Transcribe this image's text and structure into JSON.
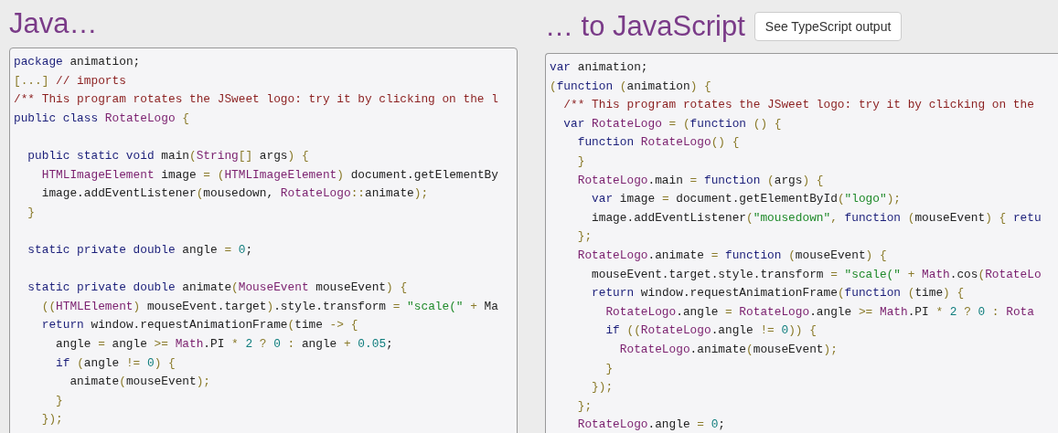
{
  "panels": [
    {
      "heading": "Java…",
      "code": [
        {
          "kind": "code",
          "tokens": [
            {
              "kind": "keyword",
              "text": "package"
            },
            {
              "kind": "identifier",
              "text": " animation;"
            }
          ]
        },
        {
          "kind": "code",
          "tokens": [
            {
              "kind": "punctuation",
              "text": "[...]"
            },
            {
              "kind": "comment",
              "text": " // imports"
            }
          ]
        },
        {
          "kind": "code",
          "tokens": [
            {
              "kind": "comment",
              "text": "/** This program rotates the JSweet logo: try it by clicking on the l"
            }
          ]
        },
        {
          "kind": "code",
          "tokens": [
            {
              "kind": "keyword",
              "text": "public class "
            },
            {
              "kind": "type",
              "text": "RotateLogo"
            },
            {
              "kind": "punctuation",
              "text": " {"
            }
          ]
        },
        {
          "kind": "blank"
        },
        {
          "kind": "code",
          "tokens": [
            {
              "kind": "keyword",
              "text": "  public static void "
            },
            {
              "kind": "identifier",
              "text": "main"
            },
            {
              "kind": "punctuation",
              "text": "("
            },
            {
              "kind": "type",
              "text": "String"
            },
            {
              "kind": "punctuation",
              "text": "[]"
            },
            {
              "kind": "identifier",
              "text": " args"
            },
            {
              "kind": "punctuation",
              "text": ") {"
            }
          ]
        },
        {
          "kind": "code",
          "tokens": [
            {
              "kind": "type",
              "text": "    HTMLImageElement"
            },
            {
              "kind": "identifier",
              "text": " image "
            },
            {
              "kind": "punctuation",
              "text": "= ("
            },
            {
              "kind": "type",
              "text": "HTMLImageElement"
            },
            {
              "kind": "punctuation",
              "text": ")"
            },
            {
              "kind": "identifier",
              "text": " document.getElementBy"
            }
          ]
        },
        {
          "kind": "code",
          "tokens": [
            {
              "kind": "identifier",
              "text": "    image.addEventListener"
            },
            {
              "kind": "punctuation",
              "text": "("
            },
            {
              "kind": "identifier",
              "text": "mousedown, "
            },
            {
              "kind": "type",
              "text": "RotateLogo"
            },
            {
              "kind": "punctuation",
              "text": "::"
            },
            {
              "kind": "identifier",
              "text": "animate"
            },
            {
              "kind": "punctuation",
              "text": ");"
            }
          ]
        },
        {
          "kind": "code",
          "tokens": [
            {
              "kind": "punctuation",
              "text": "  }"
            }
          ]
        },
        {
          "kind": "blank"
        },
        {
          "kind": "code",
          "tokens": [
            {
              "kind": "keyword",
              "text": "  static private double "
            },
            {
              "kind": "identifier",
              "text": "angle "
            },
            {
              "kind": "punctuation",
              "text": "= "
            },
            {
              "kind": "number",
              "text": "0"
            },
            {
              "kind": "identifier",
              "text": ";"
            }
          ]
        },
        {
          "kind": "blank"
        },
        {
          "kind": "code",
          "tokens": [
            {
              "kind": "keyword",
              "text": "  static private double "
            },
            {
              "kind": "identifier",
              "text": "animate"
            },
            {
              "kind": "punctuation",
              "text": "("
            },
            {
              "kind": "type",
              "text": "MouseEvent"
            },
            {
              "kind": "identifier",
              "text": " mouseEvent"
            },
            {
              "kind": "punctuation",
              "text": ") {"
            }
          ]
        },
        {
          "kind": "code",
          "tokens": [
            {
              "kind": "punctuation",
              "text": "    (("
            },
            {
              "kind": "type",
              "text": "HTMLElement"
            },
            {
              "kind": "punctuation",
              "text": ")"
            },
            {
              "kind": "identifier",
              "text": " mouseEvent.target"
            },
            {
              "kind": "punctuation",
              "text": ")"
            },
            {
              "kind": "identifier",
              "text": ".style.transform "
            },
            {
              "kind": "punctuation",
              "text": "= "
            },
            {
              "kind": "string",
              "text": "\"scale(\""
            },
            {
              "kind": "punctuation",
              "text": " + "
            },
            {
              "kind": "identifier",
              "text": "Ma"
            }
          ]
        },
        {
          "kind": "code",
          "tokens": [
            {
              "kind": "keyword",
              "text": "    return "
            },
            {
              "kind": "identifier",
              "text": "window.requestAnimationFrame"
            },
            {
              "kind": "punctuation",
              "text": "("
            },
            {
              "kind": "identifier",
              "text": "time "
            },
            {
              "kind": "punctuation",
              "text": "-> {"
            }
          ]
        },
        {
          "kind": "code",
          "tokens": [
            {
              "kind": "identifier",
              "text": "      angle "
            },
            {
              "kind": "punctuation",
              "text": "= "
            },
            {
              "kind": "identifier",
              "text": "angle "
            },
            {
              "kind": "punctuation",
              "text": ">= "
            },
            {
              "kind": "type",
              "text": "Math"
            },
            {
              "kind": "identifier",
              "text": ".PI "
            },
            {
              "kind": "punctuation",
              "text": "* "
            },
            {
              "kind": "number",
              "text": "2"
            },
            {
              "kind": "punctuation",
              "text": " ? "
            },
            {
              "kind": "number",
              "text": "0"
            },
            {
              "kind": "punctuation",
              "text": " : "
            },
            {
              "kind": "identifier",
              "text": "angle "
            },
            {
              "kind": "punctuation",
              "text": "+ "
            },
            {
              "kind": "number",
              "text": "0.05"
            },
            {
              "kind": "identifier",
              "text": ";"
            }
          ]
        },
        {
          "kind": "code",
          "tokens": [
            {
              "kind": "keyword",
              "text": "      if "
            },
            {
              "kind": "punctuation",
              "text": "("
            },
            {
              "kind": "identifier",
              "text": "angle "
            },
            {
              "kind": "punctuation",
              "text": "!= "
            },
            {
              "kind": "number",
              "text": "0"
            },
            {
              "kind": "punctuation",
              "text": ") {"
            }
          ]
        },
        {
          "kind": "code",
          "tokens": [
            {
              "kind": "identifier",
              "text": "        animate"
            },
            {
              "kind": "punctuation",
              "text": "("
            },
            {
              "kind": "identifier",
              "text": "mouseEvent"
            },
            {
              "kind": "punctuation",
              "text": ");"
            }
          ]
        },
        {
          "kind": "code",
          "tokens": [
            {
              "kind": "punctuation",
              "text": "      }"
            }
          ]
        },
        {
          "kind": "code",
          "tokens": [
            {
              "kind": "punctuation",
              "text": "    });"
            }
          ]
        }
      ]
    },
    {
      "heading": "… to JavaScript",
      "button": "See TypeScript output",
      "code": [
        {
          "kind": "code",
          "tokens": [
            {
              "kind": "keyword",
              "text": "var "
            },
            {
              "kind": "identifier",
              "text": "animation;"
            }
          ]
        },
        {
          "kind": "code",
          "tokens": [
            {
              "kind": "punctuation",
              "text": "("
            },
            {
              "kind": "keyword",
              "text": "function "
            },
            {
              "kind": "punctuation",
              "text": "("
            },
            {
              "kind": "identifier",
              "text": "animation"
            },
            {
              "kind": "punctuation",
              "text": ") {"
            }
          ]
        },
        {
          "kind": "code",
          "tokens": [
            {
              "kind": "comment",
              "text": "  /** This program rotates the JSweet logo: try it by clicking on the"
            }
          ]
        },
        {
          "kind": "code",
          "tokens": [
            {
              "kind": "keyword",
              "text": "  var "
            },
            {
              "kind": "type",
              "text": "RotateLogo"
            },
            {
              "kind": "punctuation",
              "text": " = ("
            },
            {
              "kind": "keyword",
              "text": "function "
            },
            {
              "kind": "punctuation",
              "text": "() {"
            }
          ]
        },
        {
          "kind": "code",
          "tokens": [
            {
              "kind": "keyword",
              "text": "    function "
            },
            {
              "kind": "type",
              "text": "RotateLogo"
            },
            {
              "kind": "punctuation",
              "text": "() {"
            }
          ]
        },
        {
          "kind": "code",
          "tokens": [
            {
              "kind": "punctuation",
              "text": "    }"
            }
          ]
        },
        {
          "kind": "code",
          "tokens": [
            {
              "kind": "type",
              "text": "    RotateLogo"
            },
            {
              "kind": "identifier",
              "text": ".main "
            },
            {
              "kind": "punctuation",
              "text": "= "
            },
            {
              "kind": "keyword",
              "text": "function "
            },
            {
              "kind": "punctuation",
              "text": "("
            },
            {
              "kind": "identifier",
              "text": "args"
            },
            {
              "kind": "punctuation",
              "text": ") {"
            }
          ]
        },
        {
          "kind": "code",
          "tokens": [
            {
              "kind": "keyword",
              "text": "      var "
            },
            {
              "kind": "identifier",
              "text": "image "
            },
            {
              "kind": "punctuation",
              "text": "= "
            },
            {
              "kind": "identifier",
              "text": "document.getElementById"
            },
            {
              "kind": "punctuation",
              "text": "("
            },
            {
              "kind": "string",
              "text": "\"logo\""
            },
            {
              "kind": "punctuation",
              "text": ");"
            }
          ]
        },
        {
          "kind": "code",
          "tokens": [
            {
              "kind": "identifier",
              "text": "      image.addEventListener"
            },
            {
              "kind": "punctuation",
              "text": "("
            },
            {
              "kind": "string",
              "text": "\"mousedown\""
            },
            {
              "kind": "punctuation",
              "text": ", "
            },
            {
              "kind": "keyword",
              "text": "function "
            },
            {
              "kind": "punctuation",
              "text": "("
            },
            {
              "kind": "identifier",
              "text": "mouseEvent"
            },
            {
              "kind": "punctuation",
              "text": ") { "
            },
            {
              "kind": "keyword",
              "text": "retu"
            }
          ]
        },
        {
          "kind": "code",
          "tokens": [
            {
              "kind": "punctuation",
              "text": "    };"
            }
          ]
        },
        {
          "kind": "code",
          "tokens": [
            {
              "kind": "type",
              "text": "    RotateLogo"
            },
            {
              "kind": "identifier",
              "text": ".animate "
            },
            {
              "kind": "punctuation",
              "text": "= "
            },
            {
              "kind": "keyword",
              "text": "function "
            },
            {
              "kind": "punctuation",
              "text": "("
            },
            {
              "kind": "identifier",
              "text": "mouseEvent"
            },
            {
              "kind": "punctuation",
              "text": ") {"
            }
          ]
        },
        {
          "kind": "code",
          "tokens": [
            {
              "kind": "identifier",
              "text": "      mouseEvent.target.style.transform "
            },
            {
              "kind": "punctuation",
              "text": "= "
            },
            {
              "kind": "string",
              "text": "\"scale(\""
            },
            {
              "kind": "punctuation",
              "text": " + "
            },
            {
              "kind": "type",
              "text": "Math"
            },
            {
              "kind": "identifier",
              "text": ".cos"
            },
            {
              "kind": "punctuation",
              "text": "("
            },
            {
              "kind": "type",
              "text": "RotateLo"
            }
          ]
        },
        {
          "kind": "code",
          "tokens": [
            {
              "kind": "keyword",
              "text": "      return "
            },
            {
              "kind": "identifier",
              "text": "window.requestAnimationFrame"
            },
            {
              "kind": "punctuation",
              "text": "("
            },
            {
              "kind": "keyword",
              "text": "function "
            },
            {
              "kind": "punctuation",
              "text": "("
            },
            {
              "kind": "identifier",
              "text": "time"
            },
            {
              "kind": "punctuation",
              "text": ") {"
            }
          ]
        },
        {
          "kind": "code",
          "tokens": [
            {
              "kind": "type",
              "text": "        RotateLogo"
            },
            {
              "kind": "identifier",
              "text": ".angle "
            },
            {
              "kind": "punctuation",
              "text": "= "
            },
            {
              "kind": "type",
              "text": "RotateLogo"
            },
            {
              "kind": "identifier",
              "text": ".angle "
            },
            {
              "kind": "punctuation",
              "text": ">= "
            },
            {
              "kind": "type",
              "text": "Math"
            },
            {
              "kind": "identifier",
              "text": ".PI "
            },
            {
              "kind": "punctuation",
              "text": "* "
            },
            {
              "kind": "number",
              "text": "2"
            },
            {
              "kind": "punctuation",
              "text": " ? "
            },
            {
              "kind": "number",
              "text": "0"
            },
            {
              "kind": "punctuation",
              "text": " : "
            },
            {
              "kind": "type",
              "text": "Rota"
            }
          ]
        },
        {
          "kind": "code",
          "tokens": [
            {
              "kind": "keyword",
              "text": "        if "
            },
            {
              "kind": "punctuation",
              "text": "(("
            },
            {
              "kind": "type",
              "text": "RotateLogo"
            },
            {
              "kind": "identifier",
              "text": ".angle "
            },
            {
              "kind": "punctuation",
              "text": "!= "
            },
            {
              "kind": "number",
              "text": "0"
            },
            {
              "kind": "punctuation",
              "text": ")) {"
            }
          ]
        },
        {
          "kind": "code",
          "tokens": [
            {
              "kind": "type",
              "text": "          RotateLogo"
            },
            {
              "kind": "identifier",
              "text": ".animate"
            },
            {
              "kind": "punctuation",
              "text": "("
            },
            {
              "kind": "identifier",
              "text": "mouseEvent"
            },
            {
              "kind": "punctuation",
              "text": ");"
            }
          ]
        },
        {
          "kind": "code",
          "tokens": [
            {
              "kind": "punctuation",
              "text": "        }"
            }
          ]
        },
        {
          "kind": "code",
          "tokens": [
            {
              "kind": "punctuation",
              "text": "      });"
            }
          ]
        },
        {
          "kind": "code",
          "tokens": [
            {
              "kind": "punctuation",
              "text": "    };"
            }
          ]
        },
        {
          "kind": "code",
          "tokens": [
            {
              "kind": "type",
              "text": "    RotateLogo"
            },
            {
              "kind": "identifier",
              "text": ".angle "
            },
            {
              "kind": "punctuation",
              "text": "= "
            },
            {
              "kind": "number",
              "text": "0"
            },
            {
              "kind": "identifier",
              "text": ";"
            }
          ]
        }
      ]
    }
  ]
}
